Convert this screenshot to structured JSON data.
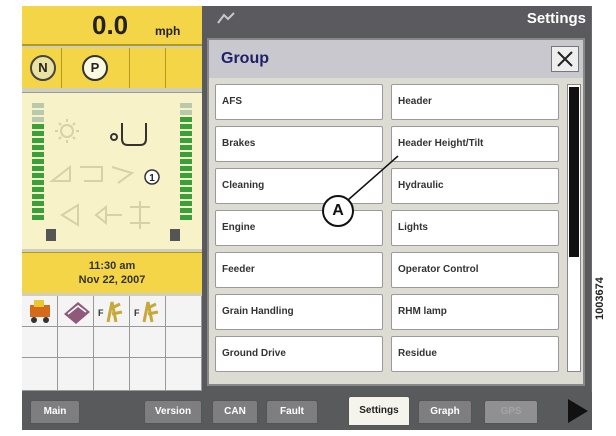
{
  "status": {
    "speed_value": "0.0",
    "speed_unit": "mph",
    "gear_neutral": "N",
    "gear_park": "P",
    "time": "11:30 am",
    "date": "Nov 22, 2007"
  },
  "header": {
    "title": "Settings"
  },
  "dialog": {
    "title": "Group",
    "close_label": "×",
    "buttons_left": [
      "AFS",
      "Brakes",
      "Cleaning",
      "Engine",
      "Feeder",
      "Grain Handling",
      "Ground Drive"
    ],
    "buttons_right": [
      "Header",
      "Header Height/Tilt",
      "Hydraulic",
      "Lights",
      "Operator Control",
      "RHM lamp",
      "Residue"
    ]
  },
  "tabs": {
    "main": "Main",
    "version": "Version",
    "can": "CAN",
    "fault": "Fault",
    "settings": "Settings",
    "graph": "Graph",
    "gps": "GPS"
  },
  "annotation": {
    "callout_label": "A",
    "figure_id": "1003674"
  },
  "colors": {
    "status_yellow": "#f4d548",
    "dialog_title": "#20206a",
    "indicator_green": "#3aa03a"
  }
}
